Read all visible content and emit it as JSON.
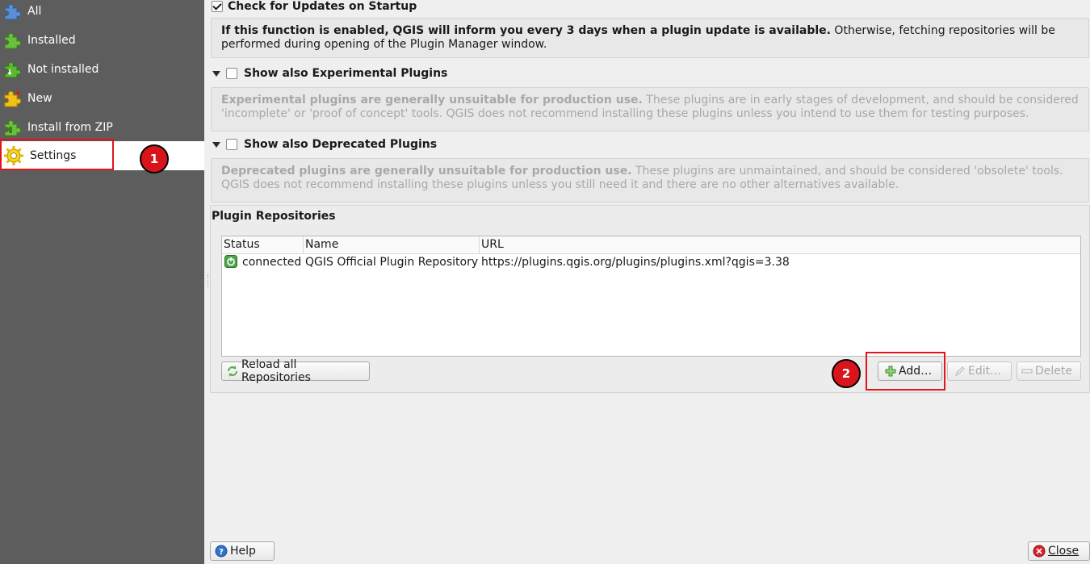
{
  "sidebar": {
    "items": [
      {
        "label": "All",
        "icon": "puzzle-blue-icon"
      },
      {
        "label": "Installed",
        "icon": "puzzle-green-icon"
      },
      {
        "label": "Not installed",
        "icon": "puzzle-green-download-icon"
      },
      {
        "label": "New",
        "icon": "puzzle-new-star-icon"
      },
      {
        "label": "Install from ZIP",
        "icon": "puzzle-zip-icon"
      },
      {
        "label": "Settings",
        "icon": "gear-icon",
        "selected": true
      }
    ]
  },
  "settings": {
    "check_updates": {
      "label": "Check for Updates on Startup",
      "checked": true,
      "desc_bold": "If this function is enabled, QGIS will inform you every 3 days when a plugin update is available.",
      "desc_rest": " Otherwise, fetching repositories will be performed during opening of the Plugin Manager window."
    },
    "experimental": {
      "label": "Show also Experimental Plugins",
      "checked": false,
      "desc_bold": "Experimental plugins are generally unsuitable for production use.",
      "desc_rest": " These plugins are in early stages of development, and should be considered 'incomplete' or 'proof of concept' tools. QGIS does not recommend installing these plugins unless you intend to use them for testing purposes."
    },
    "deprecated": {
      "label": "Show also Deprecated Plugins",
      "checked": false,
      "desc_bold": "Deprecated plugins are generally unsuitable for production use.",
      "desc_rest": " These plugins are unmaintained, and should be considered 'obsolete' tools. QGIS does not recommend installing these plugins unless you still need it and there are no other alternatives available."
    }
  },
  "repositories": {
    "title": "Plugin Repositories",
    "columns": [
      "Status",
      "Name",
      "URL"
    ],
    "rows": [
      {
        "status": "connected",
        "name": "QGIS Official Plugin Repository",
        "url": "https://plugins.qgis.org/plugins/plugins.xml?qgis=3.38"
      }
    ],
    "reload_label": "Reload all Repositories",
    "add_label": "Add…",
    "edit_label": "Edit…",
    "delete_label": "Delete"
  },
  "footer": {
    "help_label": "Help",
    "close_label": "Close"
  },
  "annotations": {
    "step1": "1",
    "step2": "2",
    "color": "#d9141a"
  }
}
